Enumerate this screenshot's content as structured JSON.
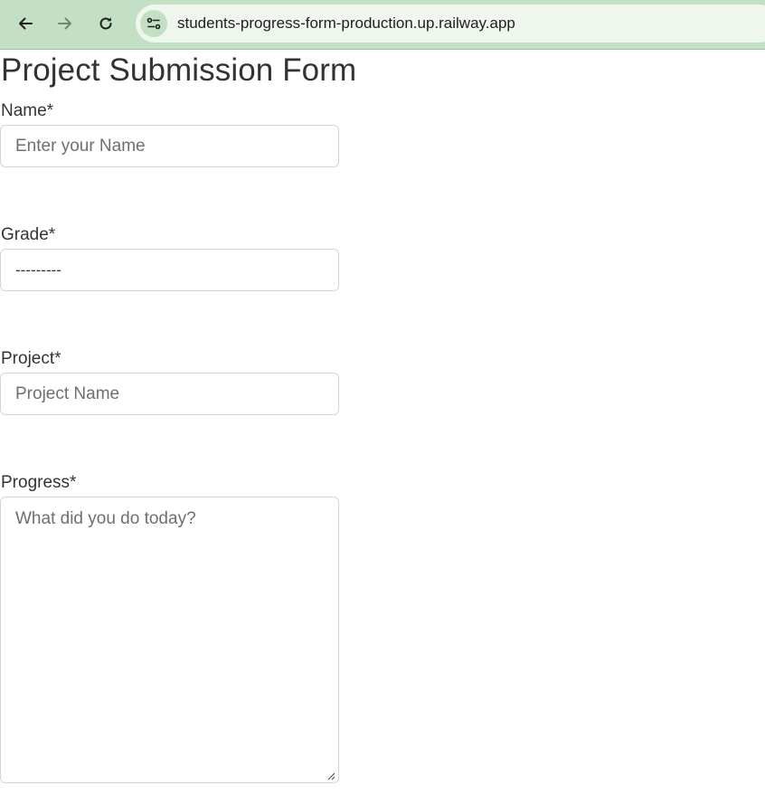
{
  "browser": {
    "url": "students-progress-form-production.up.railway.app",
    "icons": {
      "back": "arrow-left-icon",
      "forward": "arrow-right-icon",
      "reload": "reload-icon",
      "site_info": "tune-icon"
    },
    "colors": {
      "toolbar": "#c3e0c4",
      "omnibox": "#eef6ee"
    }
  },
  "form": {
    "title": "Project Submission Form",
    "name": {
      "label": "Name*",
      "placeholder": "Enter your Name",
      "value": ""
    },
    "grade": {
      "label": "Grade*",
      "selected": "---------"
    },
    "project": {
      "label": "Project*",
      "placeholder": "Project Name",
      "value": ""
    },
    "progress": {
      "label": "Progress*",
      "placeholder": "What did you do today?",
      "value": ""
    }
  }
}
